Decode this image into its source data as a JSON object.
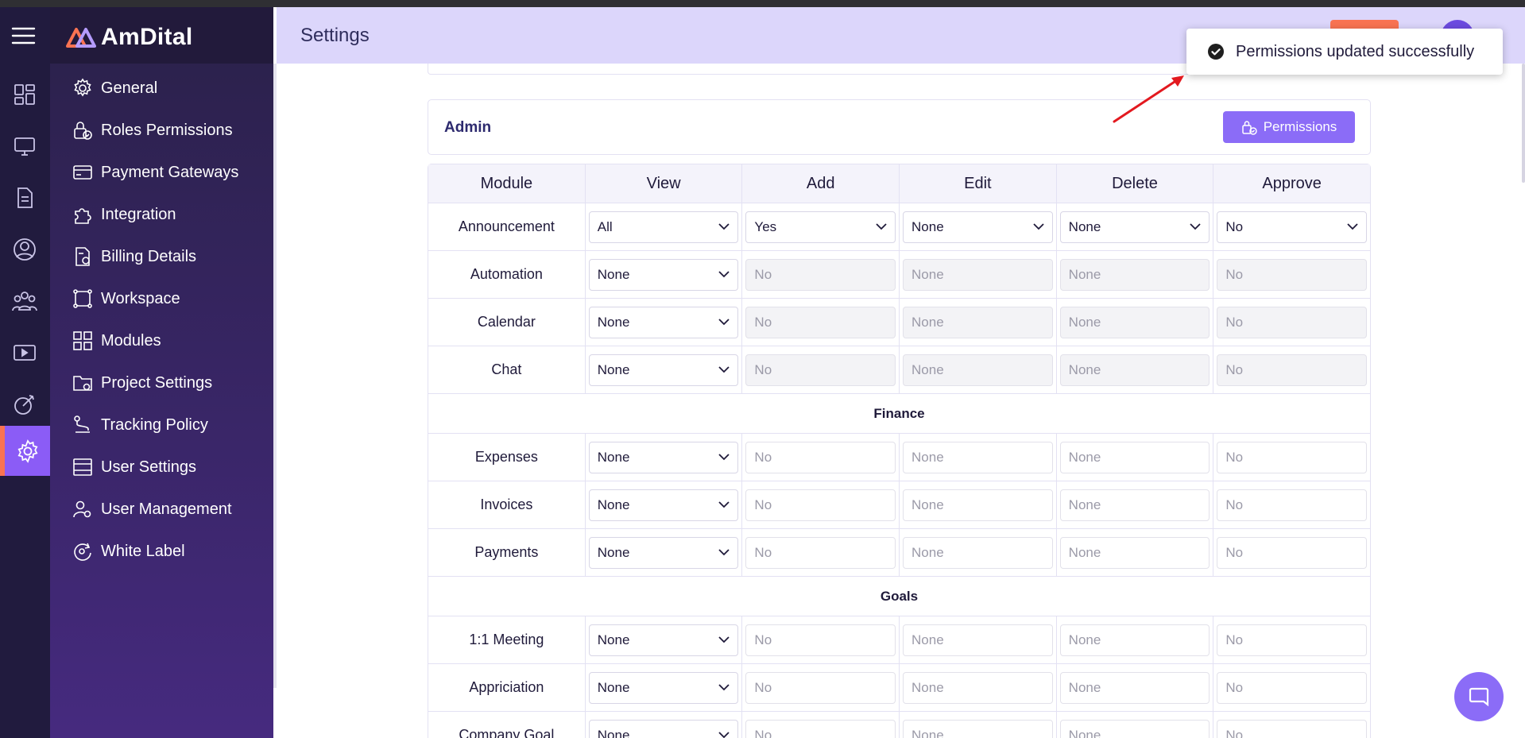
{
  "app": {
    "brand": "AmDital",
    "page_title": "Settings"
  },
  "rail": {
    "icons": [
      "menu-icon",
      "dashboard-icon",
      "monitor-icon",
      "document-icon",
      "user-circle-icon",
      "team-icon",
      "video-icon",
      "goal-icon",
      "settings-icon"
    ]
  },
  "sidebar": {
    "items": [
      {
        "label": "General",
        "icon": "gear-icon"
      },
      {
        "label": "Roles Permissions",
        "icon": "lock-icon"
      },
      {
        "label": "Payment Gateways",
        "icon": "credit-card-icon"
      },
      {
        "label": "Integration",
        "icon": "puzzle-icon"
      },
      {
        "label": "Billing Details",
        "icon": "bill-icon"
      },
      {
        "label": "Workspace",
        "icon": "workspace-icon"
      },
      {
        "label": "Modules",
        "icon": "grid-icon"
      },
      {
        "label": "Project Settings",
        "icon": "folder-gear-icon"
      },
      {
        "label": "Tracking Policy",
        "icon": "route-icon"
      },
      {
        "label": "User Settings",
        "icon": "window-icon"
      },
      {
        "label": "User Management",
        "icon": "user-gear-icon"
      },
      {
        "label": "White Label",
        "icon": "tag-icon"
      }
    ]
  },
  "role": {
    "name": "Admin",
    "permissions_button": "Permissions"
  },
  "table": {
    "headers": [
      "Module",
      "View",
      "Add",
      "Edit",
      "Delete",
      "Approve"
    ],
    "rows": [
      {
        "module": "Announcement",
        "view": "All",
        "add": "Yes",
        "edit": "None",
        "delete": "None",
        "approve": "No",
        "enabled": true
      },
      {
        "module": "Automation",
        "view": "None",
        "add": "No",
        "edit": "None",
        "delete": "None",
        "approve": "No",
        "enabled": false
      },
      {
        "module": "Calendar",
        "view": "None",
        "add": "No",
        "edit": "None",
        "delete": "None",
        "approve": "No",
        "enabled": false
      },
      {
        "module": "Chat",
        "view": "None",
        "add": "No",
        "edit": "None",
        "delete": "None",
        "approve": "No",
        "enabled": false
      }
    ],
    "sections": [
      {
        "title": "Finance",
        "rows": [
          {
            "module": "Expenses",
            "view": "None",
            "add": "No",
            "edit": "None",
            "delete": "None",
            "approve": "No"
          },
          {
            "module": "Invoices",
            "view": "None",
            "add": "No",
            "edit": "None",
            "delete": "None",
            "approve": "No"
          },
          {
            "module": "Payments",
            "view": "None",
            "add": "No",
            "edit": "None",
            "delete": "None",
            "approve": "No"
          }
        ]
      },
      {
        "title": "Goals",
        "rows": [
          {
            "module": "1:1 Meeting",
            "view": "None",
            "add": "No",
            "edit": "None",
            "delete": "None",
            "approve": "No"
          },
          {
            "module": "Appriciation",
            "view": "None",
            "add": "No",
            "edit": "None",
            "delete": "None",
            "approve": "No"
          },
          {
            "module": "Company Goal",
            "view": "None",
            "add": "No",
            "edit": "None",
            "delete": "None",
            "approve": "No"
          }
        ]
      }
    ]
  },
  "toast": {
    "message": "Permissions updated successfully"
  },
  "colors": {
    "accent": "#8b6cf7",
    "orange": "#f97352",
    "sidebar": "#2a2149",
    "header": "#dcd6fb"
  }
}
